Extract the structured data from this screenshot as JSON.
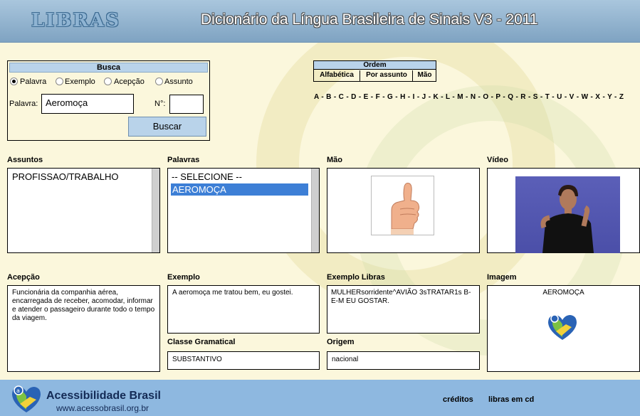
{
  "header": {
    "logo": "LIBRAS",
    "title": "Dicionário da Língua Brasileira de Sinais V3 - 2011"
  },
  "busca": {
    "title": "Busca",
    "radios": [
      {
        "label": "Palavra",
        "checked": true
      },
      {
        "label": "Exemplo",
        "checked": false
      },
      {
        "label": "Acepção",
        "checked": false
      },
      {
        "label": "Assunto",
        "checked": false
      }
    ],
    "palavra_label": "Palavra:",
    "palavra_value": "Aeromoça",
    "numero_label": "N°:",
    "numero_value": "",
    "button": "Buscar"
  },
  "ordem": {
    "title": "Ordem",
    "tabs": [
      "Alfabética",
      "Por assunto",
      "Mão"
    ]
  },
  "alphabet": "A - B - C - D - E - F - G - H - I - J - K - L - M - N - O - P - Q - R - S - T - U - V - W - X - Y - Z",
  "assuntos": {
    "label": "Assuntos",
    "items": [
      "PROFISSAO/TRABALHO"
    ]
  },
  "palavras": {
    "label": "Palavras",
    "items": [
      "-- SELECIONE --",
      "AEROMOÇA"
    ],
    "selected": "AEROMOÇA"
  },
  "mao": {
    "label": "Mão"
  },
  "video": {
    "label": "Vídeo"
  },
  "acepcao": {
    "label": "Acepção",
    "text": "Funcionária da companhia aérea, encarregada de receber, acomodar, informar e atender o passageiro durante todo o tempo da viagem."
  },
  "exemplo": {
    "label": "Exemplo",
    "text": "A aeromoça me tratou bem, eu gostei."
  },
  "exemplo_libras": {
    "label": "Exemplo Libras",
    "text": "MULHERsorridente^AVIÃO 3sTRATAR1s B-E-M EU GOSTAR."
  },
  "imagem": {
    "label": "Imagem",
    "caption": "AEROMOÇA"
  },
  "classe": {
    "label": "Classe Gramatical",
    "value": "SUBSTANTIVO"
  },
  "origem": {
    "label": "Origem",
    "value": "nacional"
  },
  "footer": {
    "name": "Acessibilidade Brasil",
    "url": "www.acessobrasil.org.br",
    "links": [
      "créditos",
      "libras em cd"
    ]
  },
  "colors": {
    "header_bg": "#8fb0cf",
    "content_bg": "#fbf7dc",
    "selection": "#3d7fd6",
    "panel_head": "#b9d3ea",
    "footer_bg": "#8eb8e0"
  },
  "icons": [
    "acessibilidade-brasil-heart-logo-icon",
    "thumbs-up-hand-icon"
  ]
}
